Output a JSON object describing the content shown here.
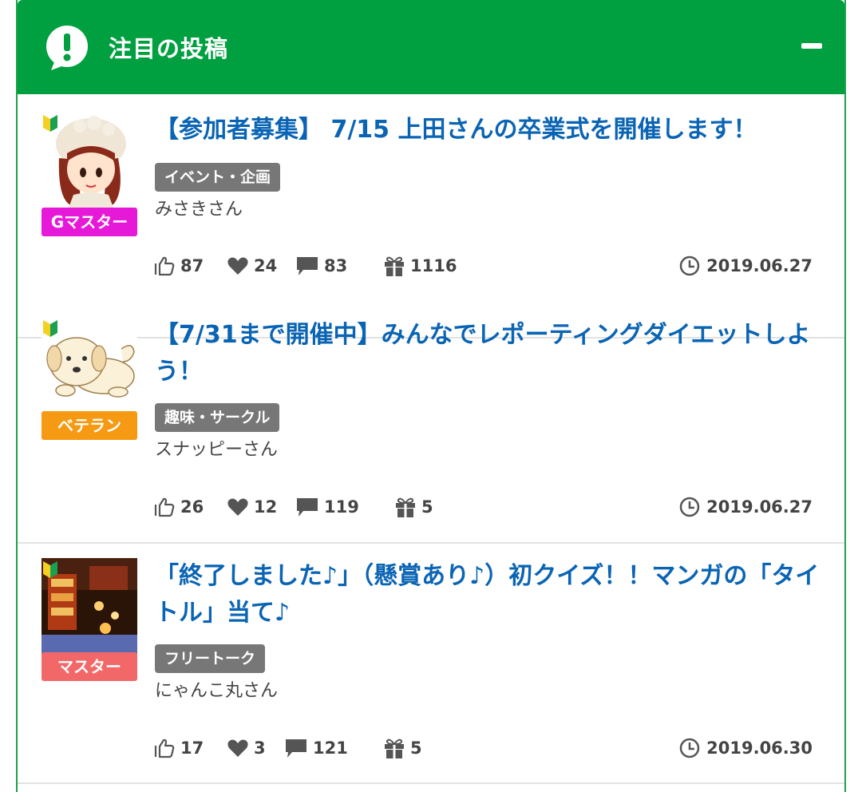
{
  "header": {
    "title": "注目の投稿",
    "icon": "alert-bubble-icon",
    "collapse_icon": "minus-icon"
  },
  "colors": {
    "header_bg": "#00a040",
    "title_link": "#0a64b4",
    "category_bg": "#777777"
  },
  "posts": [
    {
      "title": "【参加者募集】 7/15 上田さんの卒業式を開催します！",
      "category": "イベント・企画",
      "author": "みさきさん",
      "rank": "Gマスター",
      "rank_color": "#e619d8",
      "likes": "87",
      "favorites": "24",
      "comments": "83",
      "gifts": "1116",
      "date": "2019.06.27"
    },
    {
      "title": "【7/31まで開催中】みんなでレポーティングダイエットしよう！",
      "category": "趣味・サークル",
      "author": "スナッピーさん",
      "rank": "ベテラン",
      "rank_color": "#f59a12",
      "likes": "26",
      "favorites": "12",
      "comments": "119",
      "gifts": "5",
      "date": "2019.06.27"
    },
    {
      "title": "「終了しました♪」（懸賞あり♪）初クイズ！！マンガの「タイトル」当て♪",
      "category": "フリートーク",
      "author": "にゃんこ丸さん",
      "rank": "マスター",
      "rank_color": "#f26868",
      "likes": "17",
      "favorites": "3",
      "comments": "121",
      "gifts": "5",
      "date": "2019.06.30"
    }
  ]
}
